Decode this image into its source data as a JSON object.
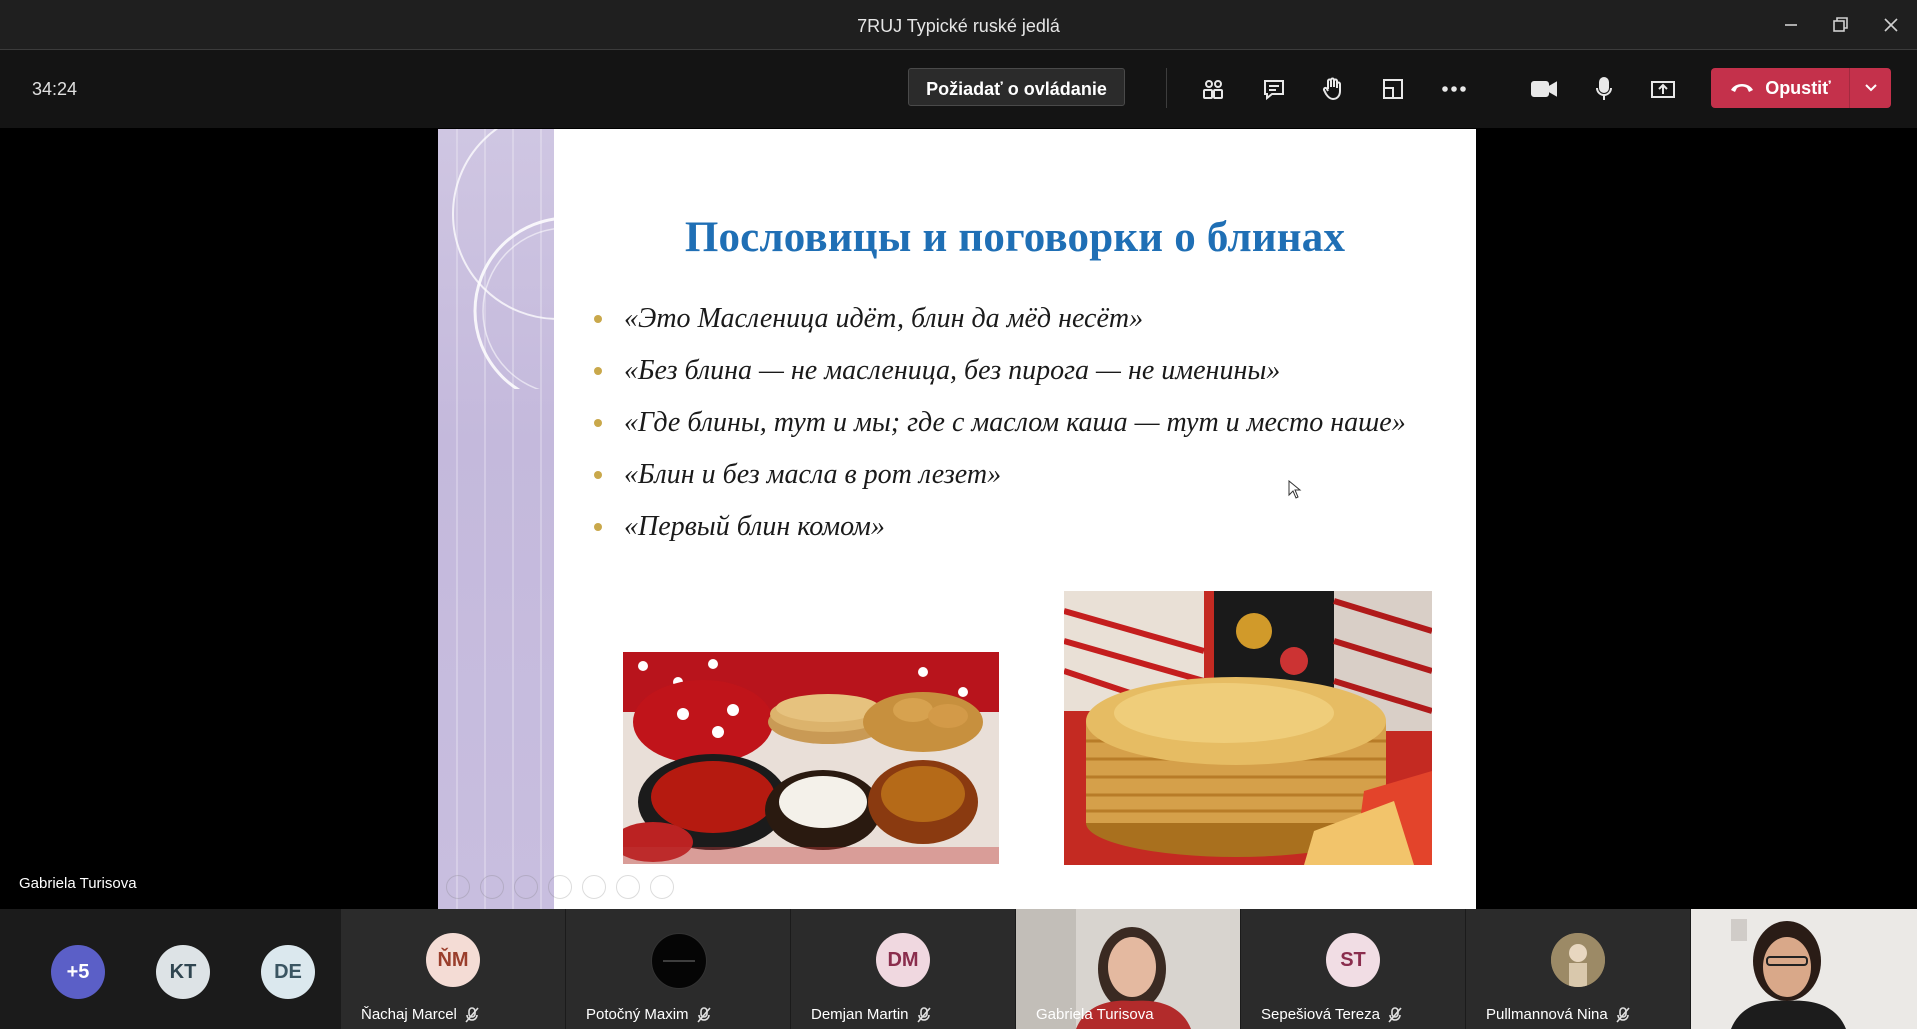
{
  "window": {
    "title": "7RUJ Typické ruské jedlá"
  },
  "toolbar": {
    "timer": "34:24",
    "request_control_label": "Požiadať o ovládanie",
    "leave_label": "Opustiť"
  },
  "presenter": {
    "name": "Gabriela Turisova"
  },
  "slide": {
    "title": "Пословицы и поговорки о блинах",
    "bullets": [
      "«Это Масленица идёт, блин да мёд несёт»",
      "«Без блина — не масленица, без пирога — не именины»",
      "«Где блины, тут и мы; где с маслом каша — тут и место наше»",
      "«Блин и без масла в рот лезет»",
      "«Первый блин комом»"
    ]
  },
  "participants": {
    "overflow": "+5",
    "avatars": [
      {
        "initials": "KT"
      },
      {
        "initials": "DE"
      }
    ],
    "tiles": [
      {
        "initials": "ŇM",
        "name": "Ňachaj Marcel"
      },
      {
        "initials": "",
        "name": "Potočný Maxim"
      },
      {
        "initials": "DM",
        "name": "Demjan Martin"
      },
      {
        "initials": "",
        "name": "Gabriela Turisova"
      },
      {
        "initials": "ST",
        "name": "Sepešiová Tereza"
      },
      {
        "initials": "",
        "name": "Pullmannová Nina"
      }
    ]
  },
  "colors": {
    "accent_leave": "#c4314b",
    "overflow_avatar": "#5b5fc7",
    "title_blue": "#1f6fb5"
  }
}
